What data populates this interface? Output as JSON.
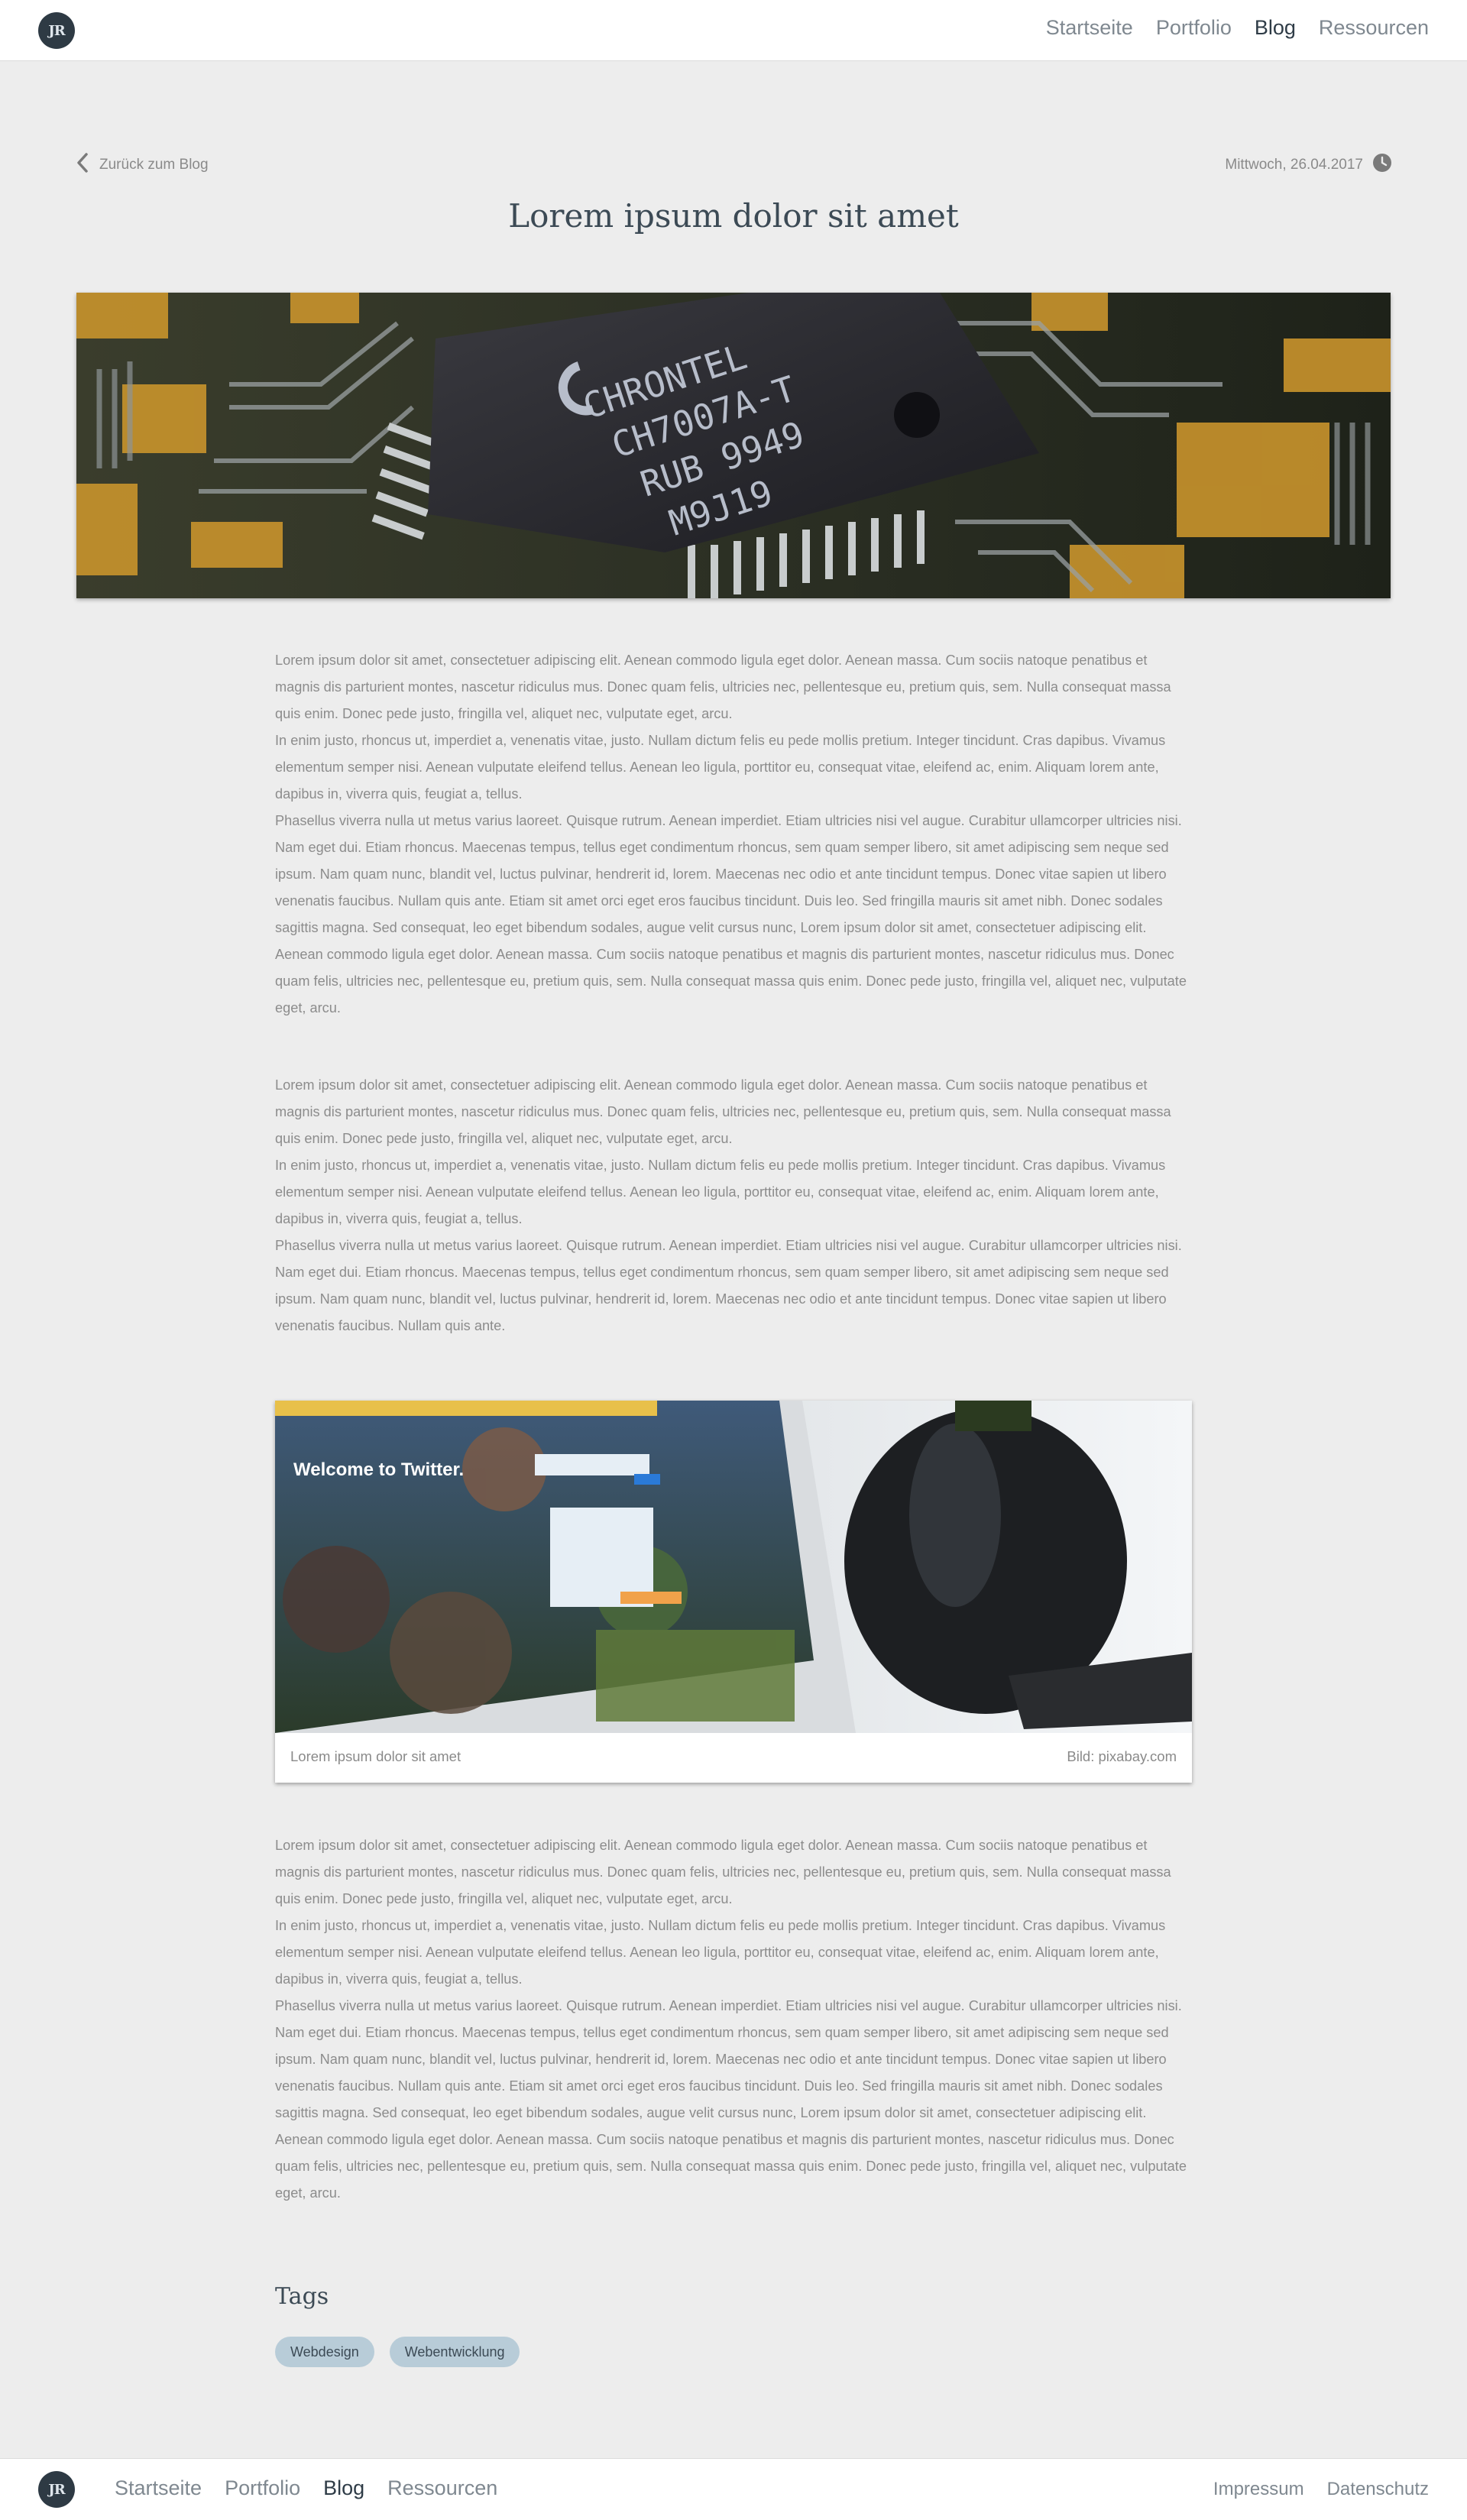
{
  "header": {
    "logo_text": "JR",
    "nav": [
      {
        "label": "Startseite",
        "active": false
      },
      {
        "label": "Portfolio",
        "active": false
      },
      {
        "label": "Blog",
        "active": true
      },
      {
        "label": "Ressourcen",
        "active": false
      }
    ]
  },
  "post": {
    "back_label": "Zurück zum Blog",
    "date": "Mittwoch, 26.04.2017",
    "title": "Lorem ipsum dolor sit amet",
    "hero_chip_text": [
      "CHRONTEL",
      "CH7007A-T",
      "RUB 9949",
      "M9J19"
    ],
    "body1": [
      "Lorem ipsum dolor sit amet, consectetuer adipiscing elit. Aenean commodo ligula eget dolor. Aenean massa. Cum sociis natoque penatibus et magnis dis parturient montes, nascetur ridiculus mus. Donec quam felis, ultricies nec, pellentesque eu, pretium quis, sem. Nulla consequat massa quis enim. Donec pede justo, fringilla vel, aliquet nec, vulputate eget, arcu.",
      "In enim justo, rhoncus ut, imperdiet a, venenatis vitae, justo. Nullam dictum felis eu pede mollis pretium. Integer tincidunt. Cras dapibus. Vivamus elementum semper nisi. Aenean vulputate eleifend tellus. Aenean leo ligula, porttitor eu, consequat vitae, eleifend ac, enim. Aliquam lorem ante, dapibus in, viverra quis, feugiat a, tellus.",
      "Phasellus viverra nulla ut metus varius laoreet. Quisque rutrum. Aenean imperdiet. Etiam ultricies nisi vel augue. Curabitur ullamcorper ultricies nisi. Nam eget dui. Etiam rhoncus. Maecenas tempus, tellus eget condimentum rhoncus, sem quam semper libero, sit amet adipiscing sem neque sed ipsum. Nam quam nunc, blandit vel, luctus pulvinar, hendrerit id, lorem. Maecenas nec odio et ante tincidunt tempus. Donec vitae sapien ut libero venenatis faucibus. Nullam quis ante. Etiam sit amet orci eget eros faucibus tincidunt. Duis leo. Sed fringilla mauris sit amet nibh. Donec sodales sagittis magna. Sed consequat, leo eget bibendum sodales, augue velit cursus nunc, Lorem ipsum dolor sit amet, consectetuer adipiscing elit. Aenean commodo ligula eget dolor. Aenean massa. Cum sociis natoque penatibus et magnis dis parturient montes, nascetur ridiculus mus. Donec quam felis, ultricies nec, pellentesque eu, pretium quis, sem. Nulla consequat massa quis enim. Donec pede justo, fringilla vel, aliquet nec, vulputate eget, arcu."
    ],
    "body2": [
      "Lorem ipsum dolor sit amet, consectetuer adipiscing elit. Aenean commodo ligula eget dolor. Aenean massa. Cum sociis natoque penatibus et magnis dis parturient montes, nascetur ridiculus mus. Donec quam felis, ultricies nec, pellentesque eu, pretium quis, sem. Nulla consequat massa quis enim. Donec pede justo, fringilla vel, aliquet nec, vulputate eget, arcu.",
      "In enim justo, rhoncus ut, imperdiet a, venenatis vitae, justo. Nullam dictum felis eu pede mollis pretium. Integer tincidunt. Cras dapibus. Vivamus elementum semper nisi. Aenean vulputate eleifend tellus. Aenean leo ligula, porttitor eu, consequat vitae, eleifend ac, enim. Aliquam lorem ante, dapibus in, viverra quis, feugiat a, tellus.",
      "Phasellus viverra nulla ut metus varius laoreet. Quisque rutrum. Aenean imperdiet. Etiam ultricies nisi vel augue. Curabitur ullamcorper ultricies nisi. Nam eget dui. Etiam rhoncus. Maecenas tempus, tellus eget condimentum rhoncus, sem quam semper libero, sit amet adipiscing sem neque sed ipsum. Nam quam nunc, blandit vel, luctus pulvinar, hendrerit id, lorem. Maecenas nec odio et ante tincidunt tempus. Donec vitae sapien ut libero venenatis faucibus. Nullam quis ante."
    ],
    "figure": {
      "screen_text": "Welcome to Twitter.",
      "caption": "Lorem ipsum dolor sit amet",
      "credit": "Bild: pixabay.com"
    },
    "body3": [
      "Lorem ipsum dolor sit amet, consectetuer adipiscing elit. Aenean commodo ligula eget dolor. Aenean massa. Cum sociis natoque penatibus et magnis dis parturient montes, nascetur ridiculus mus. Donec quam felis, ultricies nec, pellentesque eu, pretium quis, sem. Nulla consequat massa quis enim. Donec pede justo, fringilla vel, aliquet nec, vulputate eget, arcu.",
      "In enim justo, rhoncus ut, imperdiet a, venenatis vitae, justo. Nullam dictum felis eu pede mollis pretium. Integer tincidunt. Cras dapibus. Vivamus elementum semper nisi. Aenean vulputate eleifend tellus. Aenean leo ligula, porttitor eu, consequat vitae, eleifend ac, enim. Aliquam lorem ante, dapibus in, viverra quis, feugiat a, tellus.",
      "Phasellus viverra nulla ut metus varius laoreet. Quisque rutrum. Aenean imperdiet. Etiam ultricies nisi vel augue. Curabitur ullamcorper ultricies nisi. Nam eget dui. Etiam rhoncus. Maecenas tempus, tellus eget condimentum rhoncus, sem quam semper libero, sit amet adipiscing sem neque sed ipsum. Nam quam nunc, blandit vel, luctus pulvinar, hendrerit id, lorem. Maecenas nec odio et ante tincidunt tempus. Donec vitae sapien ut libero venenatis faucibus. Nullam quis ante. Etiam sit amet orci eget eros faucibus tincidunt. Duis leo. Sed fringilla mauris sit amet nibh. Donec sodales sagittis magna. Sed consequat, leo eget bibendum sodales, augue velit cursus nunc, Lorem ipsum dolor sit amet, consectetuer adipiscing elit. Aenean commodo ligula eget dolor. Aenean massa. Cum sociis natoque penatibus et magnis dis parturient montes, nascetur ridiculus mus. Donec quam felis, ultricies nec, pellentesque eu, pretium quis, sem. Nulla consequat massa quis enim. Donec pede justo, fringilla vel, aliquet nec, vulputate eget, arcu."
    ],
    "tags_heading": "Tags",
    "tags": [
      "Webdesign",
      "Webentwicklung"
    ]
  },
  "footer": {
    "logo_text": "JR",
    "nav": [
      {
        "label": "Startseite",
        "active": false
      },
      {
        "label": "Portfolio",
        "active": false
      },
      {
        "label": "Blog",
        "active": true
      },
      {
        "label": "Ressourcen",
        "active": false
      }
    ],
    "legal": [
      "Impressum",
      "Datenschutz"
    ]
  },
  "colors": {
    "background": "#ededed",
    "nav_active": "#2f3c47",
    "nav_inactive": "#7f8890",
    "tag_bg": "#b8ccd8",
    "logo_bg": "#2e3a44"
  }
}
